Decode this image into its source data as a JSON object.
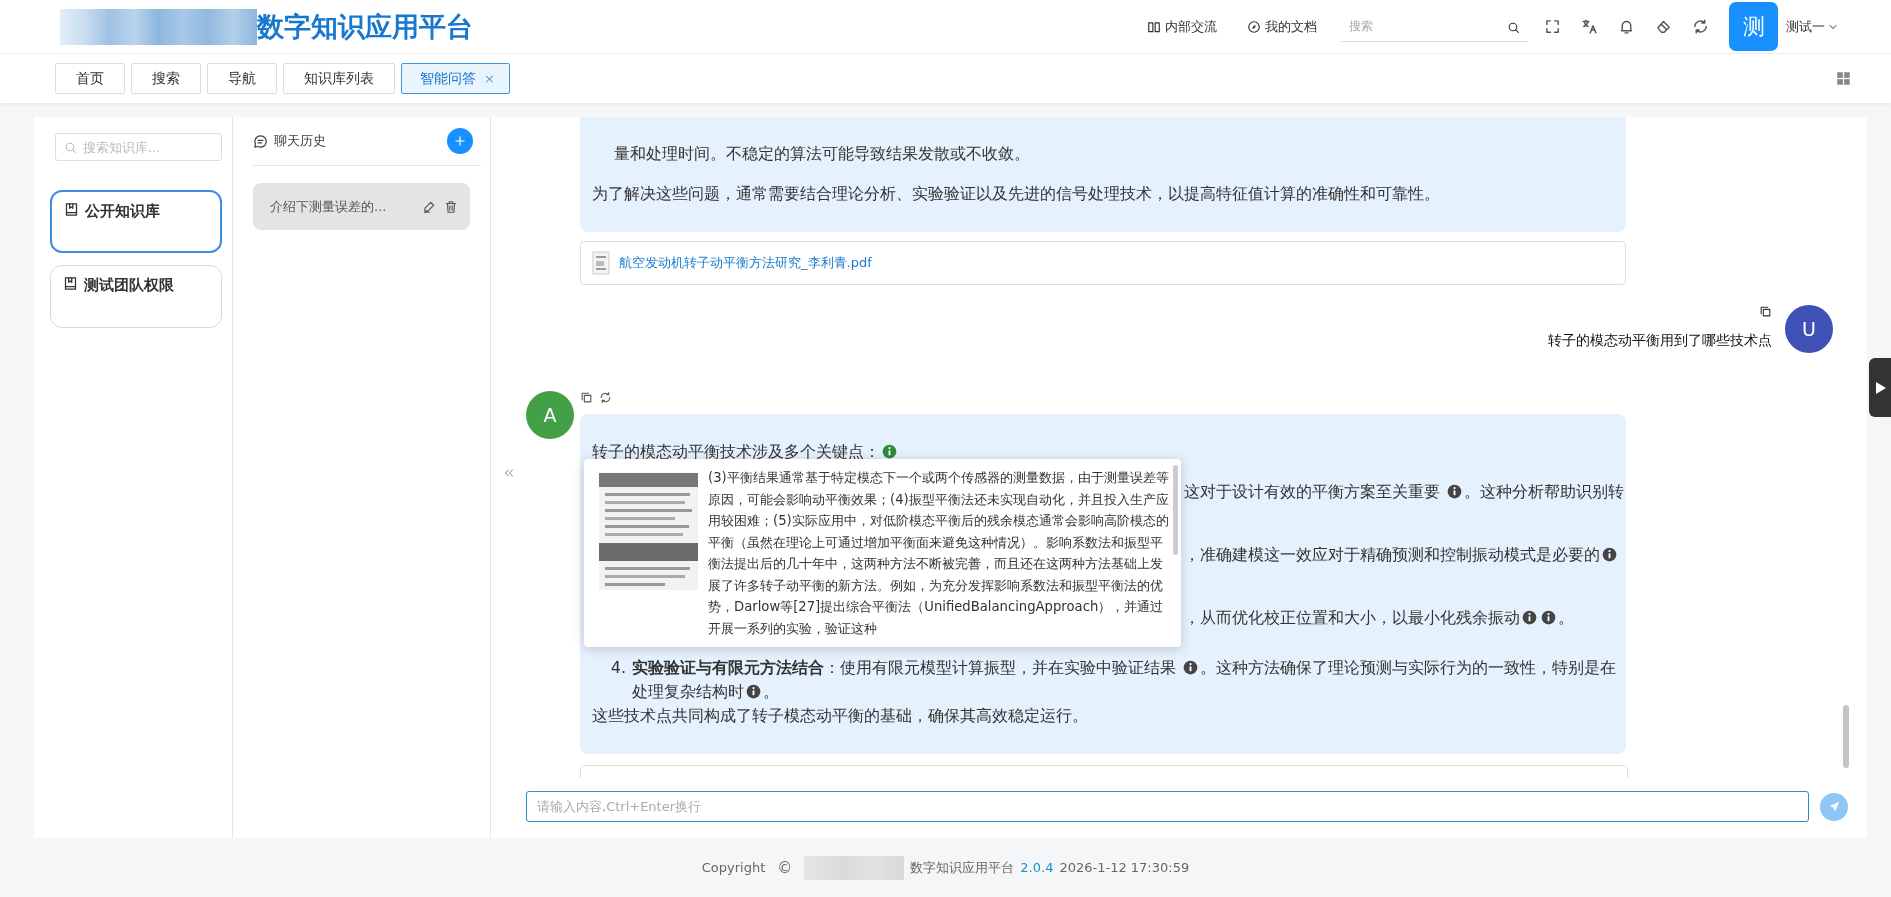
{
  "header": {
    "title": "数字知识应用平台",
    "links": [
      {
        "label": "内部交流"
      },
      {
        "label": "我的文档"
      }
    ],
    "search": {
      "placeholder": "搜索"
    },
    "user": {
      "avatar": "测",
      "name": "测试一"
    }
  },
  "tabs": [
    {
      "label": "首页",
      "selected": false
    },
    {
      "label": "搜索",
      "selected": false
    },
    {
      "label": "导航",
      "selected": false
    },
    {
      "label": "知识库列表",
      "selected": false
    },
    {
      "label": "智能问答",
      "selected": true,
      "close": "×"
    }
  ],
  "kb_search": {
    "placeholder": "搜索知识库..."
  },
  "knowledge_bases": [
    {
      "name": "公开知识库",
      "selected": true
    },
    {
      "name": "测试团队权限",
      "selected": false
    }
  ],
  "history": {
    "title": "聊天历史",
    "items": [
      {
        "title": "介绍下测量误差的...",
        "selected": true
      }
    ]
  },
  "messages": [
    {
      "kind": "assistant_tail",
      "blocks": [
        {
          "kind": "list_continuation",
          "text": "量和处理时间。不稳定的算法可能导致结果发散或不收敛。"
        },
        {
          "kind": "paragraph",
          "text": "为了解决这些问题，通常需要结合理论分析、实验验证以及先进的信号处理技术，以提高特征值计算的准确性和可靠性。"
        }
      ]
    },
    {
      "kind": "file",
      "name": "航空发动机转子动平衡方法研究_李利青.pdf"
    },
    {
      "kind": "user",
      "avatar": "U",
      "text": "转子的模态动平衡用到了哪些技术点"
    },
    {
      "kind": "assistant",
      "avatar": "A",
      "blocks": [
        {
          "kind": "paragraph",
          "segments": [
            {
              "kind": "text",
              "text": "转子的模态动平衡技术涉及多个关键点："
            },
            {
              "kind": "cite",
              "active": true
            }
          ]
        },
        {
          "kind": "fragment",
          "segments": [
            {
              "kind": "text",
              "text": "这对于设计有效的平衡方案至关重要 "
            },
            {
              "kind": "cite",
              "active": false
            },
            {
              "kind": "text",
              "text": "。这种分析帮助识别转"
            }
          ]
        },
        {
          "kind": "fragment",
          "segments": [
            {
              "kind": "text",
              "text": "，准确建模这一效应对于精确预测和控制振动模式是必要的"
            },
            {
              "kind": "cite",
              "active": false
            }
          ]
        },
        {
          "kind": "fragment",
          "segments": [
            {
              "kind": "text",
              "text": "，从而优化校正位置和大小，以最小化残余振动"
            },
            {
              "kind": "cite",
              "active": false
            },
            {
              "kind": "cite",
              "active": false
            },
            {
              "kind": "text",
              "text": "。"
            }
          ]
        },
        {
          "kind": "list_item",
          "number": "4.",
          "lines": [
            {
              "segments": [
                {
                  "kind": "text",
                  "text": "**实验验证与有限元方法结合**：使用有限元模型计算振型，并在实验中验证结果 "
                },
                {
                  "kind": "cite",
                  "active": false
                },
                {
                  "kind": "text",
                  "text": "。这种方法确保了理论预测与实际行为的一致性，特别是在"
                }
              ]
            },
            {
              "segments": [
                {
                  "kind": "text",
                  "text": "处理复杂结构时"
                },
                {
                  "kind": "cite",
                  "active": false
                },
                {
                  "kind": "text",
                  "text": "。"
                }
              ]
            }
          ]
        },
        {
          "kind": "paragraph",
          "segments": [
            {
              "kind": "text",
              "text": "这些技术点共同构成了转子模态动平衡的基础，确保其高效稳定运行。"
            }
          ]
        }
      ]
    },
    {
      "kind": "cut_card"
    }
  ],
  "popup": {
    "text": "(3)平衡结果通常基于特定模态下一个或两个传感器的测量数据，由于测量误差等原因，可能会影响动平衡效果；(4)振型平衡法还未实现自动化，并且投入生产应用较困难；(5)实际应用中，对低阶模态平衡后的残余模态通常会影响高阶模态的平衡（虽然在理论上可通过增加平衡面来避免这种情况）。影响系数法和振型平衡法提出后的几十年中，这两种方法不断被完善，而且还在这两种方法基础上发展了许多转子动平衡的新方法。例如，为充分发挥影响系数法和振型平衡法的优势，Darlow等[27]提出综合平衡法（UnifiedBalancingApproach），并通过开展一系列的实验，验证这种"
  },
  "input": {
    "placeholder": "请输入内容,Ctrl+Enter换行"
  },
  "footer": {
    "copyright": "Copyright",
    "symbol": "©",
    "product": "数字知识应用平台",
    "version": "2.0.4",
    "timestamp": "2026-1-12 17:30:59"
  }
}
